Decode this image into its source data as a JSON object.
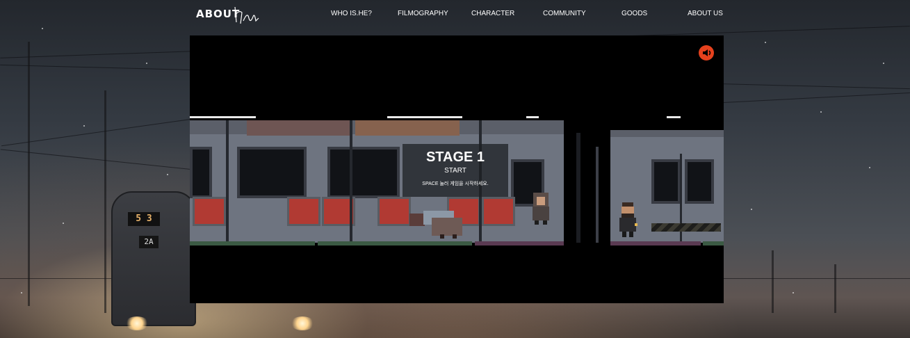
{
  "nav": {
    "logo_text": "ABOUT",
    "items": [
      {
        "label": "WHO IS.HE?"
      },
      {
        "label": "FILMOGRAPHY"
      },
      {
        "label": "CHARACTER"
      },
      {
        "label": "COMMUNITY"
      },
      {
        "label": "GOODS"
      },
      {
        "label": "ABOUT US"
      }
    ]
  },
  "background": {
    "route_number": "5 3",
    "route_sub": "2A"
  },
  "game": {
    "stage_title": "STAGE 1",
    "stage_status": "START",
    "instruction": "SPACE 눌러 게임을 시작하세요.",
    "sound_icon": "speaker-icon",
    "accent_color": "#e5411d"
  }
}
